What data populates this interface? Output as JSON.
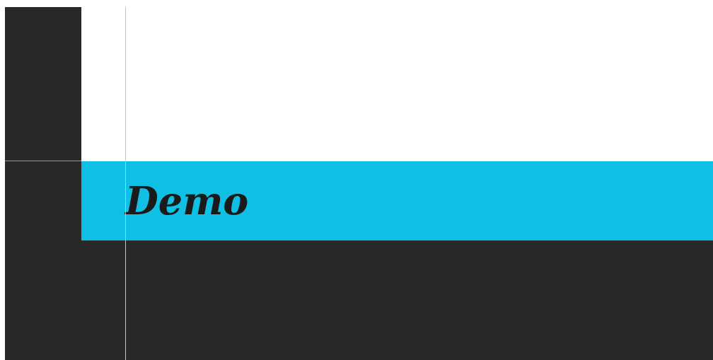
{
  "canvas": {
    "banner_text": "Demo"
  }
}
